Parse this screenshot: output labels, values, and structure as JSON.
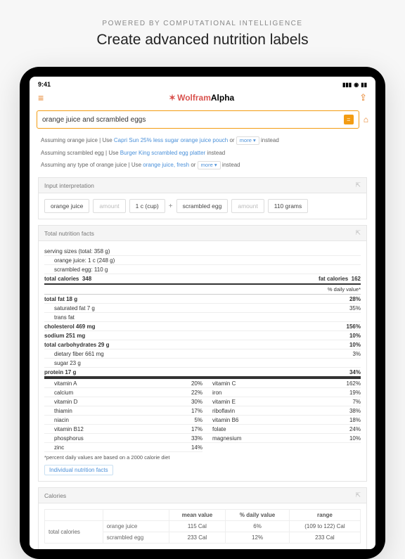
{
  "promo": {
    "subtitle": "POWERED BY COMPUTATIONAL INTELLIGENCE",
    "title": "Create advanced nutrition labels"
  },
  "status": {
    "time": "9:41"
  },
  "app": {
    "brand_prefix": "Wolfram",
    "brand_suffix": "Alpha"
  },
  "search": {
    "query": "orange juice and scrambled eggs"
  },
  "assumptions": [
    {
      "prefix": "Assuming orange juice  |  Use ",
      "link": "Capri Sun 25% less sugar orange juice pouch",
      "sep": " or ",
      "more": "more",
      "tail": " instead"
    },
    {
      "prefix": "Assuming scrambled egg  |  Use ",
      "link": "Burger King scrambled egg platter",
      "tail": " instead"
    },
    {
      "prefix": "Assuming any type of orange juice  |  Use ",
      "link": "orange juice, fresh",
      "sep": " or ",
      "more": "more",
      "tail": " instead"
    }
  ],
  "sections": {
    "input_interpretation": {
      "title": "Input interpretation",
      "chips": [
        "orange juice",
        "amount",
        "1 c  (cup)",
        "+",
        "scrambled egg",
        "amount",
        "110 grams"
      ]
    },
    "total_nutrition": {
      "title": "Total nutrition facts"
    },
    "calories": {
      "title": "Calories"
    }
  },
  "nutrition": {
    "serving_header": "serving sizes (total: 358 g)",
    "serving_oj": "orange juice:  1 c (248 g)",
    "serving_egg": "scrambled egg:  110 g",
    "total_calories_label": "total calories",
    "total_calories_val": "348",
    "fat_calories_label": "fat calories",
    "fat_calories_val": "162",
    "daily_value_header": "% daily value*",
    "rows": [
      {
        "label": "total fat",
        "val": "18 g",
        "dv": "28%",
        "bold": true
      },
      {
        "label": "saturated fat",
        "val": "7 g",
        "dv": "35%",
        "indent": true
      },
      {
        "label": "trans fat",
        "val": "",
        "dv": "",
        "indent": true
      },
      {
        "label": "cholesterol",
        "val": "469 mg",
        "dv": "156%",
        "bold": true
      },
      {
        "label": "sodium",
        "val": "251 mg",
        "dv": "10%",
        "bold": true
      },
      {
        "label": "total carbohydrates",
        "val": "29 g",
        "dv": "10%",
        "bold": true
      },
      {
        "label": "dietary fiber",
        "val": "661 mg",
        "dv": "3%",
        "indent": true
      },
      {
        "label": "sugar",
        "val": "23 g",
        "dv": "",
        "indent": true
      },
      {
        "label": "protein",
        "val": "17 g",
        "dv": "34%",
        "bold": true
      }
    ],
    "vitamins": [
      {
        "l": "vitamin A",
        "lv": "20%",
        "r": "vitamin C",
        "rv": "162%"
      },
      {
        "l": "calcium",
        "lv": "22%",
        "r": "iron",
        "rv": "19%"
      },
      {
        "l": "vitamin D",
        "lv": "30%",
        "r": "vitamin E",
        "rv": "7%"
      },
      {
        "l": "thiamin",
        "lv": "17%",
        "r": "riboflavin",
        "rv": "38%"
      },
      {
        "l": "niacin",
        "lv": "5%",
        "r": "vitamin B6",
        "rv": "18%"
      },
      {
        "l": "vitamin B12",
        "lv": "17%",
        "r": "folate",
        "rv": "24%"
      },
      {
        "l": "phosphorus",
        "lv": "33%",
        "r": "magnesium",
        "rv": "10%"
      },
      {
        "l": "zinc",
        "lv": "14%",
        "r": "",
        "rv": ""
      }
    ],
    "footnote": "*percent daily values are based on a 2000 calorie diet",
    "individual_button": "Individual nutrition facts"
  },
  "calories_table": {
    "headers": [
      "",
      "",
      "mean value",
      "% daily value",
      "range"
    ],
    "row_label": "total calories",
    "rows": [
      {
        "name": "orange juice",
        "mean": "115 Cal",
        "dv": "6%",
        "range": "(109 to 122) Cal"
      },
      {
        "name": "scrambled egg",
        "mean": "233 Cal",
        "dv": "12%",
        "range": "233 Cal"
      }
    ]
  }
}
